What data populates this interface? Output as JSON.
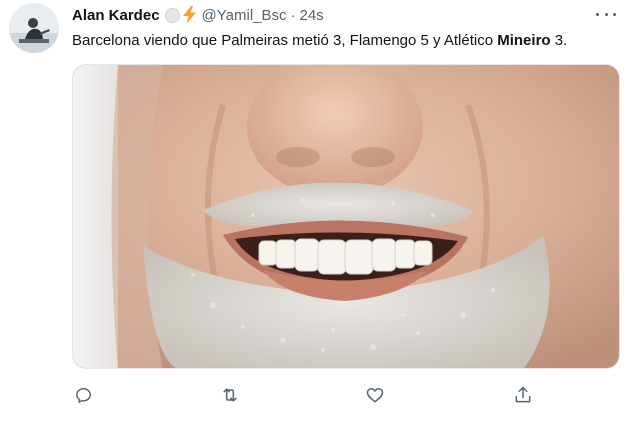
{
  "tweet": {
    "author_name": "Alan Kardec",
    "handle": "@Yamil_Bsc",
    "separator": "·",
    "time": "24s",
    "text_before": "Barcelona viendo que Palmeiras metió 3, Flamengo 5 y Atlético ",
    "text_bold": "Mineiro",
    "text_after": " 3."
  },
  "icons": {
    "reply": "reply-icon",
    "retweet": "retweet-icon",
    "like": "like-icon",
    "share": "share-icon",
    "more": "more-options-icon"
  },
  "colors": {
    "text_primary": "#0f1419",
    "text_secondary": "#536471",
    "bolt": "#f4a52a"
  }
}
